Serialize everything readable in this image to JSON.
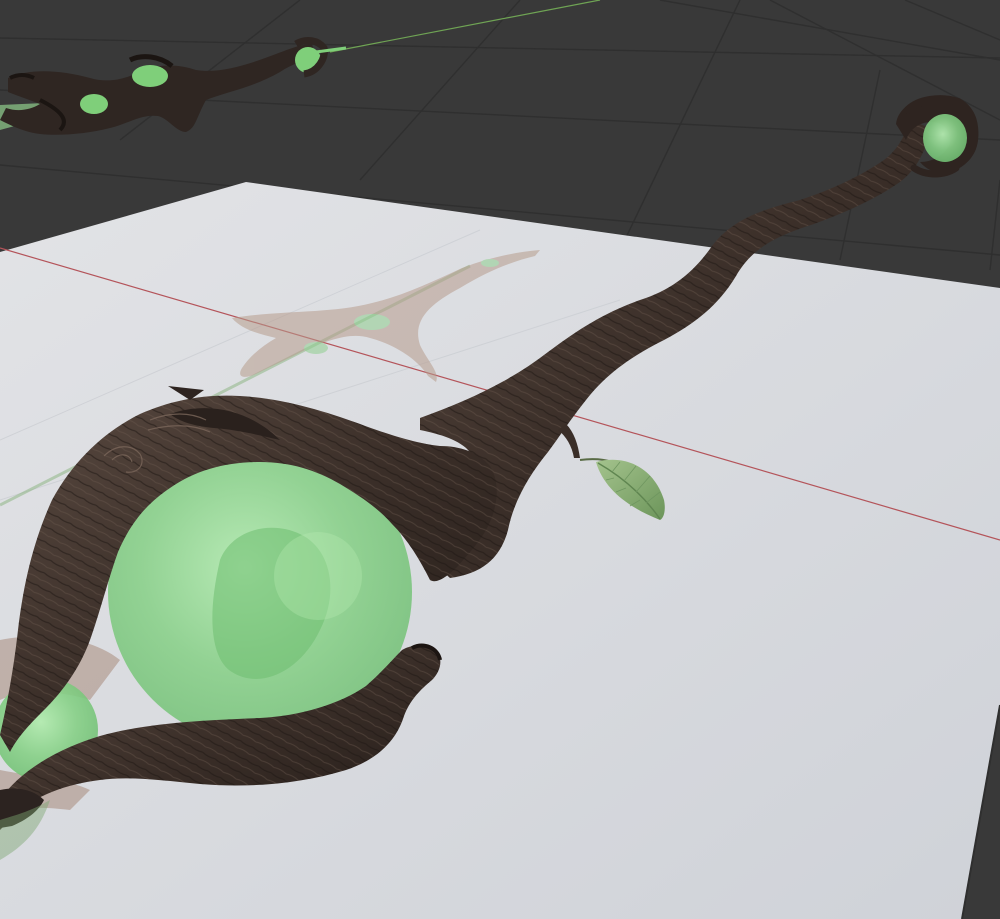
{
  "viewport": {
    "background_color": "#393939",
    "grid_line_color": "#2f2f2f",
    "x_axis_color": "#b4545a",
    "y_axis_color": "#6fa454",
    "plane_color": "#d9dbdf",
    "plane_shadow_color": "#c7c9ce"
  },
  "objects": {
    "staff_main": {
      "wood_color": "#3a2e28",
      "wood_highlight": "#6c5a4f",
      "orb_color": "#8fd487",
      "leaf_color": "#8db07b"
    },
    "staff_background": {
      "wood_color": "#2f2622",
      "orb_color": "#7fcf7a"
    },
    "reflection": {
      "color": "#b79c8d"
    }
  }
}
